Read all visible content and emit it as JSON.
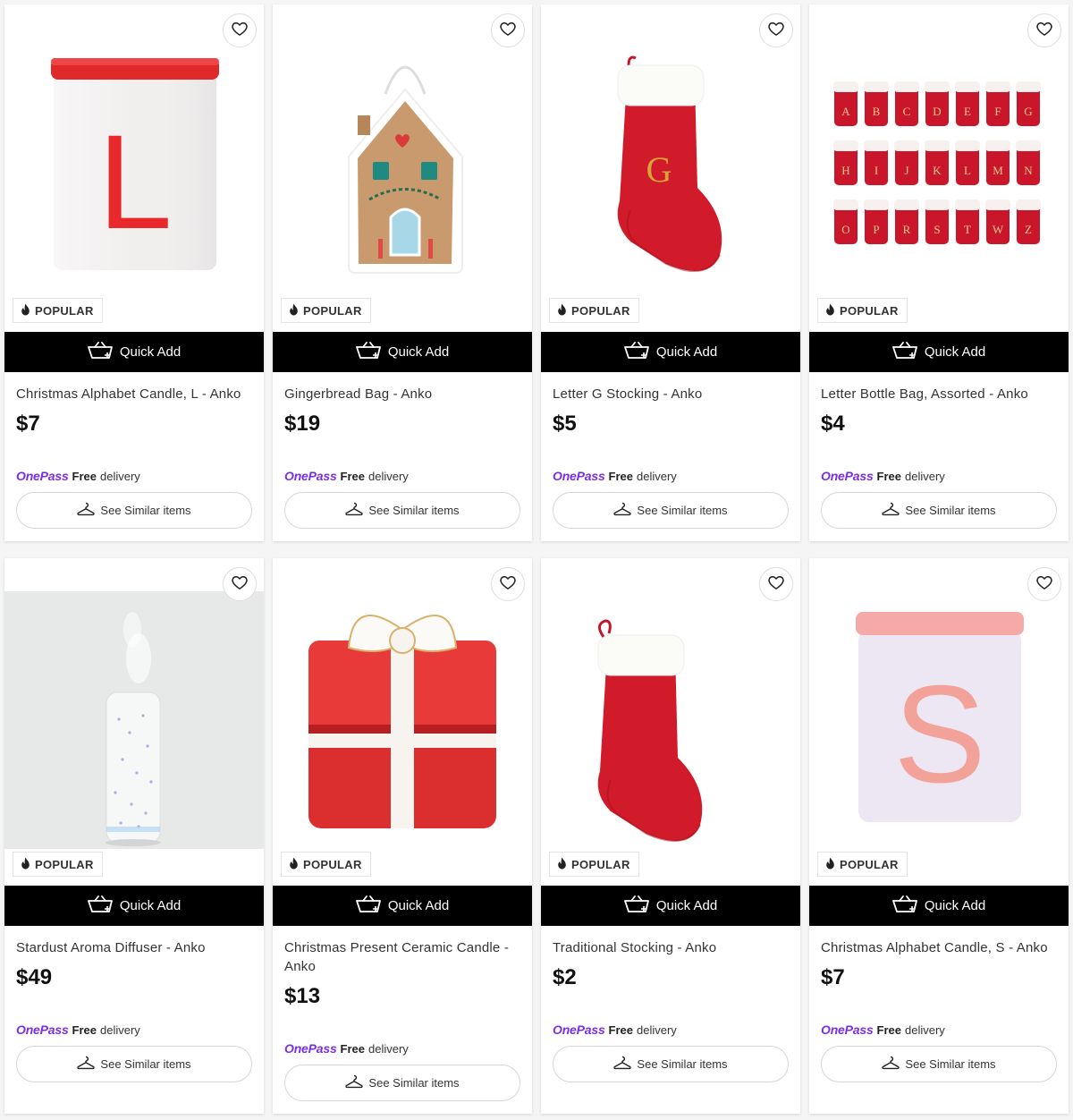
{
  "labels": {
    "badge": "POPULAR",
    "quick_add": "Quick Add",
    "onepass_brand": "OnePass",
    "free": "Free",
    "delivery": "delivery",
    "see_similar": "See Similar items"
  },
  "colors": {
    "onepass_purple": "#7b2fe0",
    "quick_add_bg": "#000000"
  },
  "products": [
    {
      "title": "Christmas Alphabet Candle, L - Anko",
      "price": "$7",
      "image": "white tin candle with red lid and letter L",
      "icon": "candle-tin"
    },
    {
      "title": "Gingerbread Bag - Anko",
      "price": "$19",
      "image": "gingerbread house shaped bag",
      "icon": "gingerbread-bag"
    },
    {
      "title": "Letter G Stocking - Anko",
      "price": "$5",
      "image": "red velvet stocking with gold letter G",
      "icon": "stocking"
    },
    {
      "title": "Letter Bottle Bag, Assorted - Anko",
      "price": "$4",
      "image": "rows of red letter bottle bags",
      "icon": "bottle-bags"
    },
    {
      "title": "Stardust Aroma Diffuser - Anko",
      "price": "$49",
      "image": "white aroma diffuser with mist",
      "icon": "diffuser"
    },
    {
      "title": "Christmas Present Ceramic Candle - Anko",
      "price": "$13",
      "image": "red ceramic present candle with white bow",
      "icon": "present"
    },
    {
      "title": "Traditional Stocking - Anko",
      "price": "$2",
      "image": "red stocking with white cuff",
      "icon": "stocking"
    },
    {
      "title": "Christmas Alphabet Candle, S - Anko",
      "price": "$7",
      "image": "lilac tin candle with pink lid and letter S",
      "icon": "candle-tin"
    }
  ],
  "image_text": {
    "candle_l": "L",
    "stocking_g": "G",
    "candle_s": "S",
    "bottle_letters": [
      "A",
      "B",
      "C",
      "D",
      "E",
      "F",
      "G",
      "H",
      "I",
      "J",
      "K",
      "L",
      "M",
      "N",
      "O",
      "P",
      "R",
      "S",
      "T",
      "W",
      "Z"
    ]
  }
}
